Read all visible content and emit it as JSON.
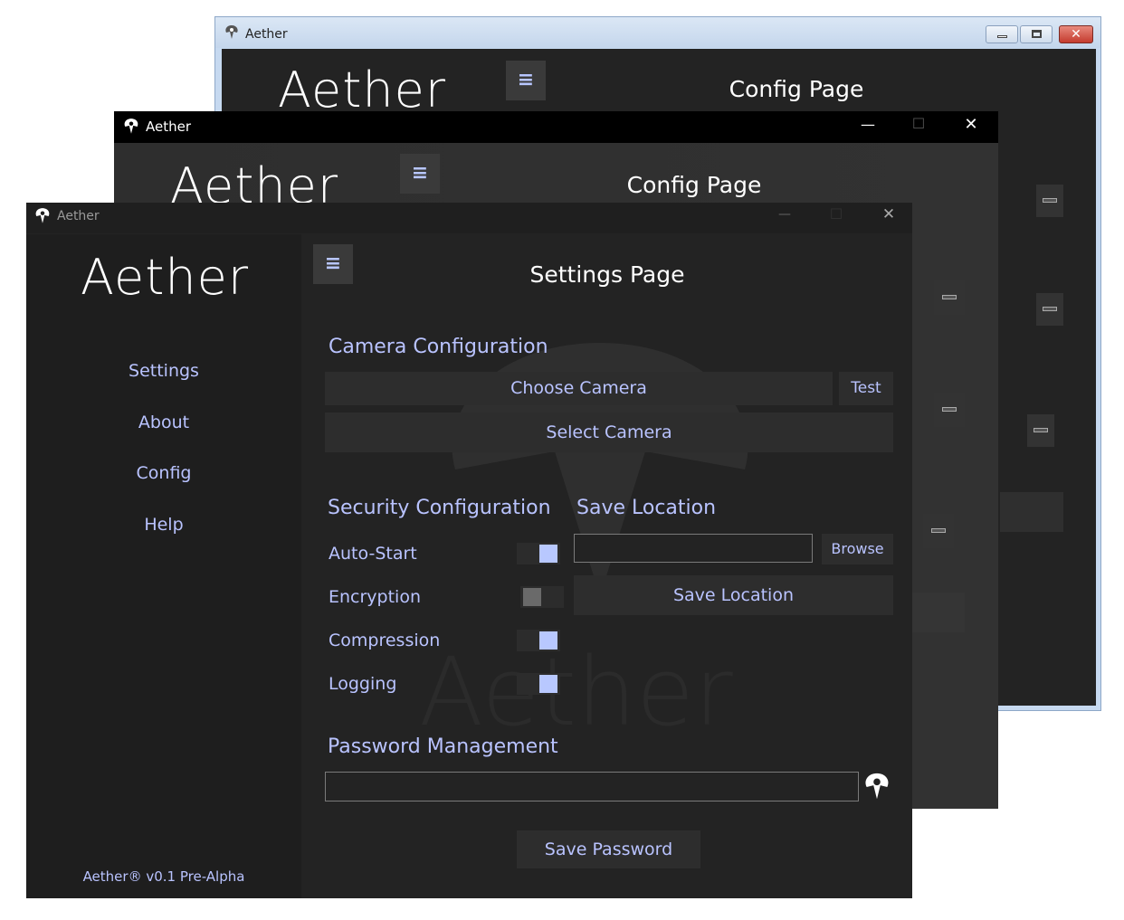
{
  "windows": {
    "back": {
      "title": "Aether",
      "logo": "Aether",
      "menu_glyph": "≡",
      "page_title": "Config Page"
    },
    "middle": {
      "title": "Aether",
      "logo": "Aether",
      "menu_glyph": "≡",
      "page_title": "Config Page",
      "controls": {
        "minimize": "—",
        "maximize": "☐",
        "close": "✕"
      }
    },
    "front": {
      "title": "Aether",
      "logo": "Aether",
      "menu_glyph": "≡",
      "page_title": "Settings Page",
      "controls": {
        "minimize": "—",
        "maximize": "☐",
        "close": "✕"
      },
      "sidebar": {
        "items": [
          "Settings",
          "About",
          "Config",
          "Help"
        ],
        "footer": "Aether® v0.1 Pre-Alpha"
      },
      "camera": {
        "heading": "Camera Configuration",
        "choose_label": "Choose Camera",
        "test_label": "Test",
        "select_label": "Select Camera"
      },
      "security": {
        "heading": "Security Configuration",
        "toggles": [
          {
            "label": "Auto-Start",
            "on": true
          },
          {
            "label": "Encryption",
            "on": false
          },
          {
            "label": "Compression",
            "on": true
          },
          {
            "label": "Logging",
            "on": true
          }
        ]
      },
      "save_location": {
        "heading": "Save Location",
        "path_value": "",
        "browse_label": "Browse",
        "save_label": "Save Location"
      },
      "password": {
        "heading": "Password Management",
        "value": "",
        "save_label": "Save Password"
      },
      "watermark": "Aether"
    }
  },
  "colors": {
    "accent": "#b9c3ff",
    "toggle_on": "#b8c8ff",
    "toggle_off": "#6a6a6a",
    "window_bg": "#232323",
    "sidebar_bg": "#1e1e1e",
    "titlebar_black": "#000000",
    "win7_border": "#c5d8ef",
    "close_red": "#c8433a"
  }
}
